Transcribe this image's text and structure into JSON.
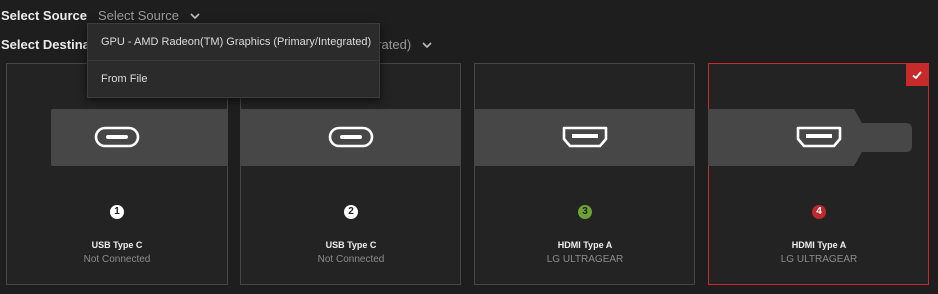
{
  "source": {
    "label": "Select Source",
    "value": "Select Source",
    "options": [
      "GPU - AMD Radeon(TM) Graphics (Primary/Integrated)",
      "From File"
    ]
  },
  "destination": {
    "label": "Select Destinatio",
    "value": "grated)"
  },
  "ports": [
    {
      "number": "1",
      "name": "USB Type C",
      "status": "Not Connected",
      "badge_color": "#ffffff"
    },
    {
      "number": "2",
      "name": "USB Type C",
      "status": "Not Connected",
      "badge_color": "#ffffff"
    },
    {
      "number": "3",
      "name": "HDMI Type A",
      "status": "LG ULTRAGEAR",
      "badge_color": "#6ea134"
    },
    {
      "number": "4",
      "name": "HDMI Type A",
      "status": "LG ULTRAGEAR",
      "badge_color": "#c0292b"
    }
  ],
  "icons": {
    "usb_c": "usb-c-port-icon",
    "hdmi": "hdmi-port-icon",
    "check": "check-icon",
    "chevron": "chevron-down-icon"
  },
  "accent": "#c62a2a"
}
